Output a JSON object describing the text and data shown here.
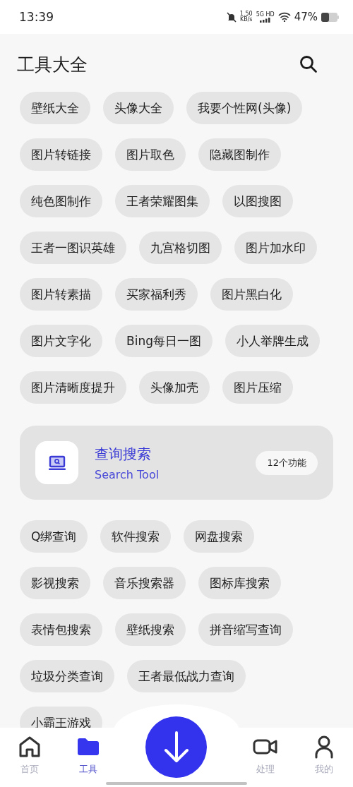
{
  "status_bar": {
    "time": "13:39",
    "speed_value": "1.50",
    "speed_unit": "KB/s",
    "network": "5G HD",
    "battery": "47%"
  },
  "header": {
    "title": "工具大全"
  },
  "tools_top": [
    "壁纸大全",
    "头像大全",
    "我要个性网(头像)",
    "图片转链接",
    "图片取色",
    "隐藏图制作",
    "纯色图制作",
    "王者荣耀图集",
    "以图搜图",
    "王者一图识英雄",
    "九宫格切图",
    "图片加水印",
    "图片转素描",
    "买家福利秀",
    "图片黑白化",
    "图片文字化",
    "Bing每日一图",
    "小人举牌生成",
    "图片清晰度提升",
    "头像加壳",
    "图片压缩"
  ],
  "category": {
    "title": "查询搜索",
    "subtitle": "Search Tool",
    "count": "12个功能"
  },
  "tools": [
    "Q绑查询",
    "软件搜索",
    "网盘搜索",
    "影视搜索",
    "音乐搜索器",
    "图标库搜索",
    "表情包搜索",
    "壁纸搜索",
    "拼音缩写查询",
    "垃圾分类查询",
    "王者最低战力查询",
    "小霸王游戏"
  ],
  "bottom_nav": [
    {
      "label": "首页",
      "kind": "home",
      "selected": false
    },
    {
      "label": "工具",
      "kind": "folder",
      "selected": true
    },
    {
      "label": "处理",
      "kind": "video",
      "selected": false
    },
    {
      "label": "我的",
      "kind": "person",
      "selected": false
    }
  ]
}
